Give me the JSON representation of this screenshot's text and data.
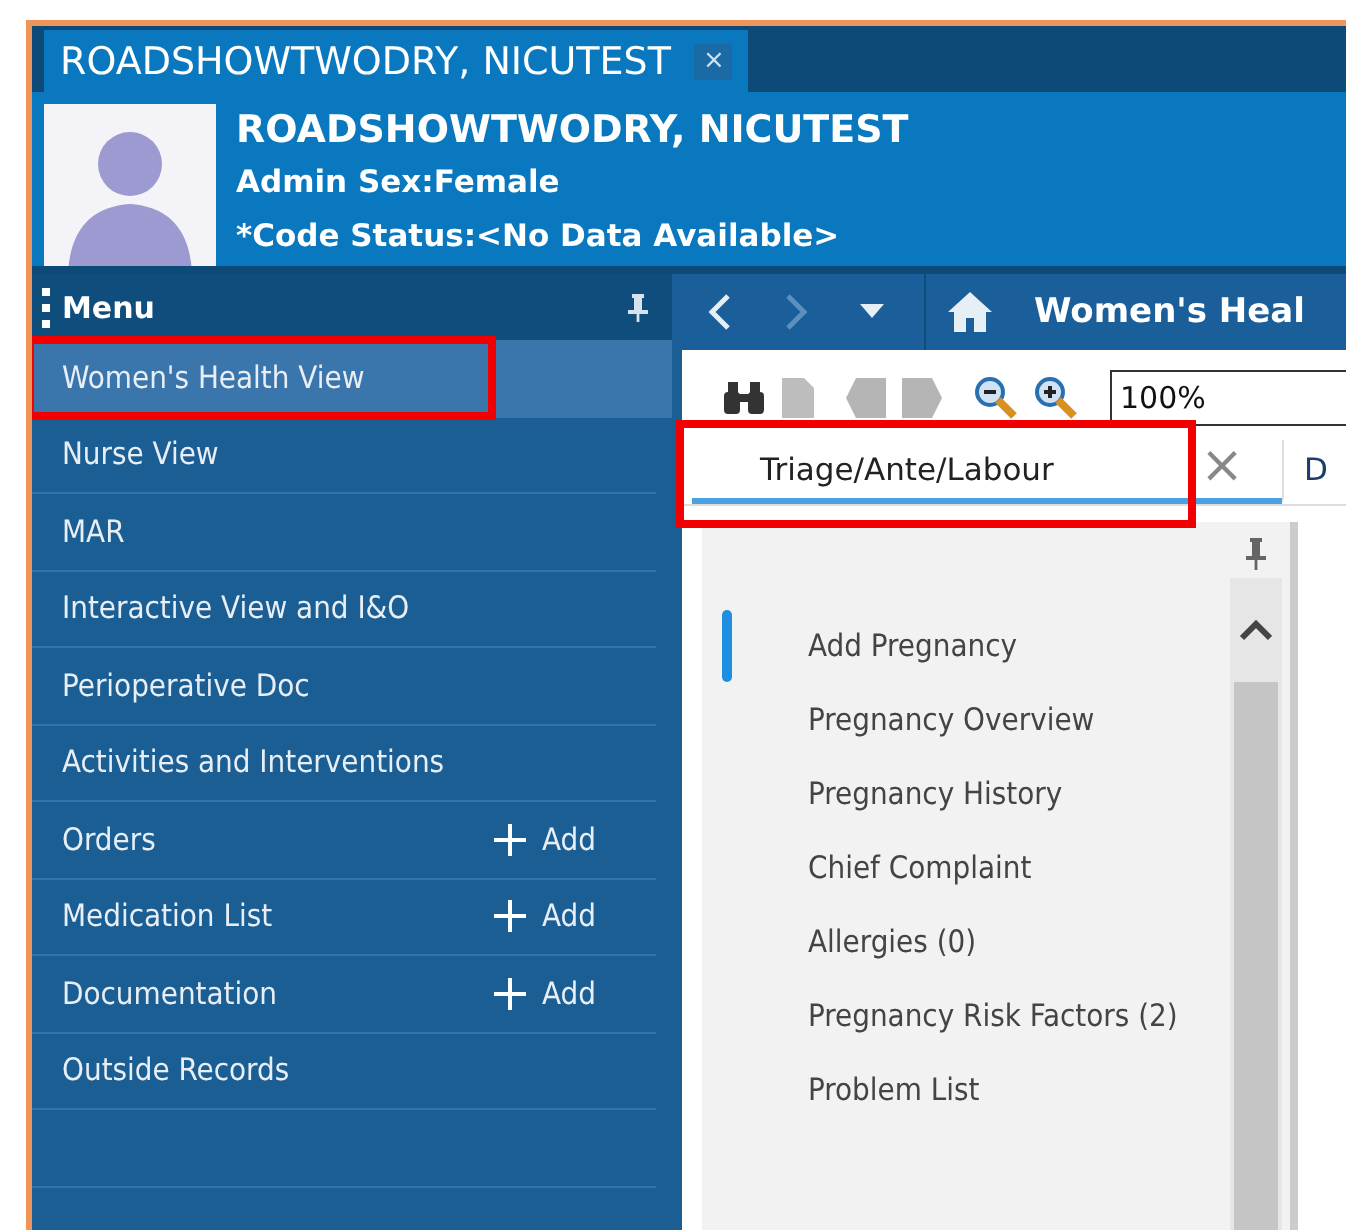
{
  "patient_tab": {
    "label": "ROADSHOWTWODRY, NICUTEST",
    "close": "×"
  },
  "banner": {
    "name": "ROADSHOWTWODRY, NICUTEST",
    "sex": "Admin Sex:Female",
    "code_status": "*Code Status:<No Data Available>"
  },
  "menu": {
    "title": "Menu",
    "items": [
      {
        "label": "Women's Health View",
        "selected": true,
        "highlighted": true
      },
      {
        "label": "Nurse View",
        "selected": false,
        "highlighted": false
      },
      {
        "label": "MAR",
        "selected": false,
        "highlighted": false
      },
      {
        "label": "Interactive View and I&O",
        "selected": false,
        "highlighted": false
      },
      {
        "label": "Perioperative Doc",
        "selected": false,
        "highlighted": false
      },
      {
        "label": "Activities and Interventions",
        "selected": false,
        "highlighted": false
      },
      {
        "label": "Orders",
        "selected": false,
        "highlighted": false,
        "action": "Add"
      },
      {
        "label": "Medication List",
        "selected": false,
        "highlighted": false,
        "action": "Add"
      },
      {
        "label": "Documentation",
        "selected": false,
        "highlighted": false,
        "action": "Add"
      },
      {
        "label": "Outside Records",
        "selected": false,
        "highlighted": false
      }
    ]
  },
  "nav": {
    "title": "Women's Heal"
  },
  "toolbar": {
    "zoom": "100%"
  },
  "tabs": [
    {
      "label": "Triage/Ante/Labour",
      "selected": true,
      "highlighted": true,
      "close": "×"
    },
    {
      "label": "D",
      "selected": false,
      "highlighted": false
    }
  ],
  "sections": [
    {
      "label": "Add Pregnancy",
      "selected": true
    },
    {
      "label": "Pregnancy Overview",
      "selected": false
    },
    {
      "label": "Pregnancy History",
      "selected": false
    },
    {
      "label": "Chief Complaint",
      "selected": false
    },
    {
      "label": "Allergies (0)",
      "selected": false
    },
    {
      "label": "Pregnancy Risk Factors (2)",
      "selected": false
    },
    {
      "label": "Problem List",
      "selected": false
    }
  ]
}
